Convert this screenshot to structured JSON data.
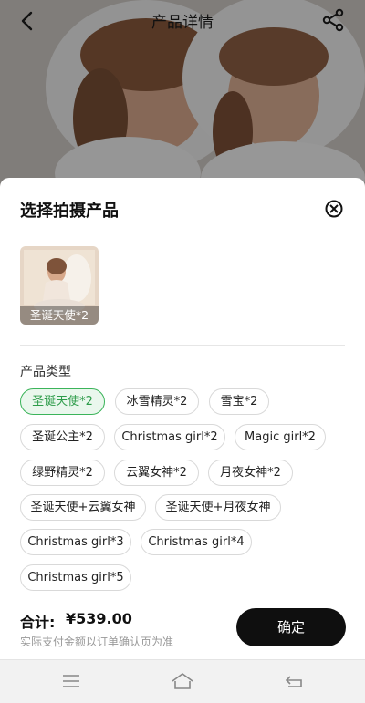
{
  "header": {
    "title": "产品详情",
    "back_icon": "back-arrow-icon",
    "share_icon": "share-icon"
  },
  "sheet": {
    "title": "选择拍摄产品",
    "close_icon": "close-circle-icon",
    "product": {
      "label": "圣诞天使*2"
    },
    "type_label": "产品类型",
    "options": [
      {
        "label": "圣诞天使*2",
        "selected": true
      },
      {
        "label": "冰雪精灵*2",
        "selected": false
      },
      {
        "label": "雪宝*2",
        "selected": false
      },
      {
        "label": "圣诞公主*2",
        "selected": false
      },
      {
        "label": "Christmas girl*2",
        "selected": false
      },
      {
        "label": "Magic girl*2",
        "selected": false
      },
      {
        "label": "绿野精灵*2",
        "selected": false
      },
      {
        "label": "云翼女神*2",
        "selected": false
      },
      {
        "label": "月夜女神*2",
        "selected": false
      },
      {
        "label": "圣诞天使+云翼女神",
        "selected": false
      },
      {
        "label": "圣诞天使+月夜女神",
        "selected": false
      },
      {
        "label": "Christmas girl*3",
        "selected": false
      },
      {
        "label": "Christmas girl*4",
        "selected": false
      },
      {
        "label": "Christmas girl*5",
        "selected": false
      }
    ]
  },
  "footer": {
    "total_label": "合计:",
    "total_price": "¥539.00",
    "note": "实际支付金额以订单确认页为准",
    "confirm_label": "确定"
  },
  "navbar": {
    "icons": [
      "menu-icon",
      "home-icon",
      "back-icon"
    ]
  },
  "colors": {
    "selected_chip": "#3bb45a",
    "confirm_button": "#0f0f0f"
  }
}
